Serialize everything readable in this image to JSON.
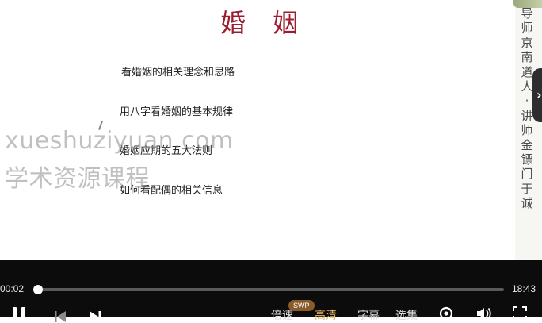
{
  "slide": {
    "title": "婚 姻",
    "topics": [
      "看婚姻的相关理念和思路",
      "用八字看婚姻的基本规律",
      "婚姻应期的五大法则",
      "如何看配偶的相关信息"
    ],
    "side_caption": [
      "导",
      "师",
      "京",
      "南",
      "道",
      "人",
      "·",
      "讲",
      "师",
      "金",
      "镖",
      "门",
      "于",
      "诚"
    ],
    "watermark_line1": "xueshuziyuan.com",
    "watermark_line2": "学术资源课程"
  },
  "player": {
    "current_time": "00:02",
    "duration": "18:43",
    "progress_fraction": 0.002,
    "menu": {
      "speed": "倍速",
      "quality": "高清",
      "subtitle": "字幕",
      "episodes": "选集"
    },
    "badge": "SWP",
    "accent_color": "#e3b96a",
    "icons": [
      "pause-icon",
      "previous-icon",
      "next-icon",
      "settings-icon",
      "volume-icon",
      "fullscreen-icon",
      "side-panel-chevron-icon"
    ]
  }
}
